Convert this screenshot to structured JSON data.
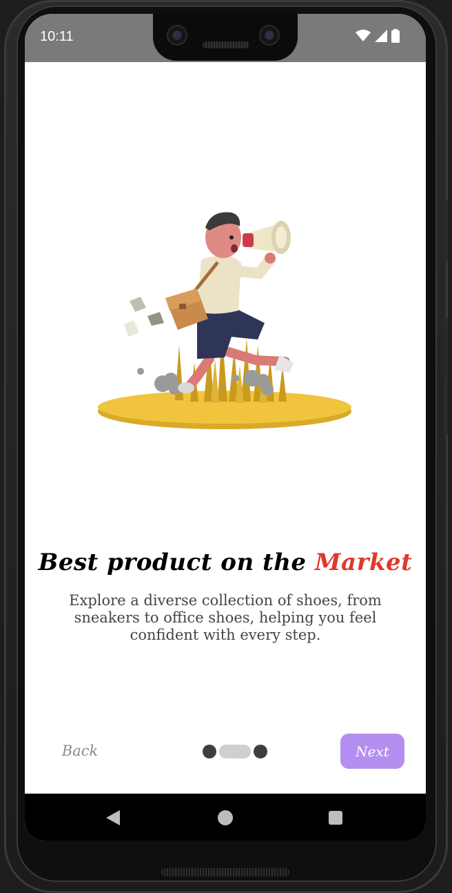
{
  "status_bar": {
    "time": "10:11",
    "icons": [
      "wifi-icon",
      "signal-icon",
      "battery-icon"
    ]
  },
  "onboarding": {
    "illustration": "person-with-megaphone-illustration",
    "headline_main": "Best product on the ",
    "headline_accent": "Market",
    "description": "Explore a diverse collection of shoes, from sneakers to office shoes, helping you feel confident with every step.",
    "pager": {
      "total_pages": 3,
      "current_page": 2
    }
  },
  "buttons": {
    "back_label": "Back",
    "next_label": "Next"
  },
  "nav_bar": {
    "icons": [
      "back-triangle-icon",
      "home-circle-icon",
      "recents-square-icon"
    ]
  },
  "colors": {
    "accent_red": "#e0392b",
    "next_button": "#b48ff0",
    "status_bar": "#7a7a7a",
    "dot_dark": "#3e3e3e",
    "dot_active": "#cfcfcf"
  }
}
